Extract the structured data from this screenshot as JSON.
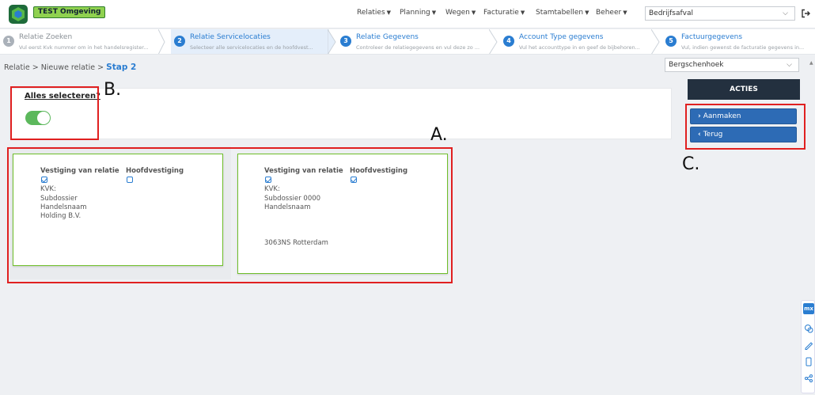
{
  "header": {
    "env_badge": "TEST Omgeving",
    "nav": [
      {
        "label": "Relaties",
        "name": "nav-relaties"
      },
      {
        "label": "Planning",
        "name": "nav-planning"
      },
      {
        "label": "Wegen",
        "name": "nav-wegen"
      },
      {
        "label": "Facturatie",
        "name": "nav-facturatie"
      },
      {
        "label": "Stamtabellen",
        "name": "nav-stamtabellen"
      },
      {
        "label": "Beheer",
        "name": "nav-beheer"
      }
    ],
    "company": "Bedrijfsafval",
    "logo_icon": "app-logo-icon",
    "logout_icon": "logout-icon"
  },
  "wizard": [
    {
      "num": "1",
      "title": "Relatie Zoeken",
      "desc": "Vul eerst Kvk nummer om in het handelsregister...",
      "state": "done"
    },
    {
      "num": "2",
      "title": "Relatie Servicelocaties",
      "desc": "Selecteer alle servicelocaties en de hoofdvest...",
      "state": "active"
    },
    {
      "num": "3",
      "title": "Relatie Gegevens",
      "desc": "Controleer de relatiegegevens en vul deze zo ...",
      "state": "todo"
    },
    {
      "num": "4",
      "title": "Account Type gegevens",
      "desc": "Vul het accounttype in en geef de bijbehoren...",
      "state": "todo"
    },
    {
      "num": "5",
      "title": "Factuurgegevens",
      "desc": "Vul, indien gewenst de facturatie gegevens in...",
      "state": "todo"
    }
  ],
  "breadcrumb": {
    "prefix": "Relatie > Nieuwe relatie > ",
    "current": "Stap 2"
  },
  "location_select": "Bergschenhoek",
  "select_all": {
    "label": "Alles selecteren?",
    "on": true
  },
  "annotations": {
    "a": "A.",
    "b": "B.",
    "c": "C."
  },
  "cards": [
    {
      "col1_header": "Vestiging van relatie",
      "col2_header": "Hoofdvestiging",
      "col1_checked": true,
      "col2_checked": false,
      "kvk": "KVK:",
      "lines": [
        "Subdossier",
        "Handelsnaam",
        "Holding B.V."
      ],
      "address": ""
    },
    {
      "col1_header": "Vestiging van relatie",
      "col2_header": "Hoofdvestiging",
      "col1_checked": true,
      "col2_checked": true,
      "kvk": "KVK:",
      "lines": [
        "Subdossier 0000",
        "Handelsnaam"
      ],
      "address": "3063NS Rotterdam"
    }
  ],
  "actions": {
    "title": "ACTIES",
    "buttons": [
      {
        "label": "Aanmaken",
        "icon": "chevron-right-icon"
      },
      {
        "label": "Terug",
        "icon": "chevron-left-icon"
      }
    ]
  },
  "colors": {
    "accent": "#2a7dd1",
    "toggle_on": "#5cb85c",
    "card_border": "#6fbf2a",
    "annotation_red": "#e02020",
    "actions_header": "#23303f"
  }
}
